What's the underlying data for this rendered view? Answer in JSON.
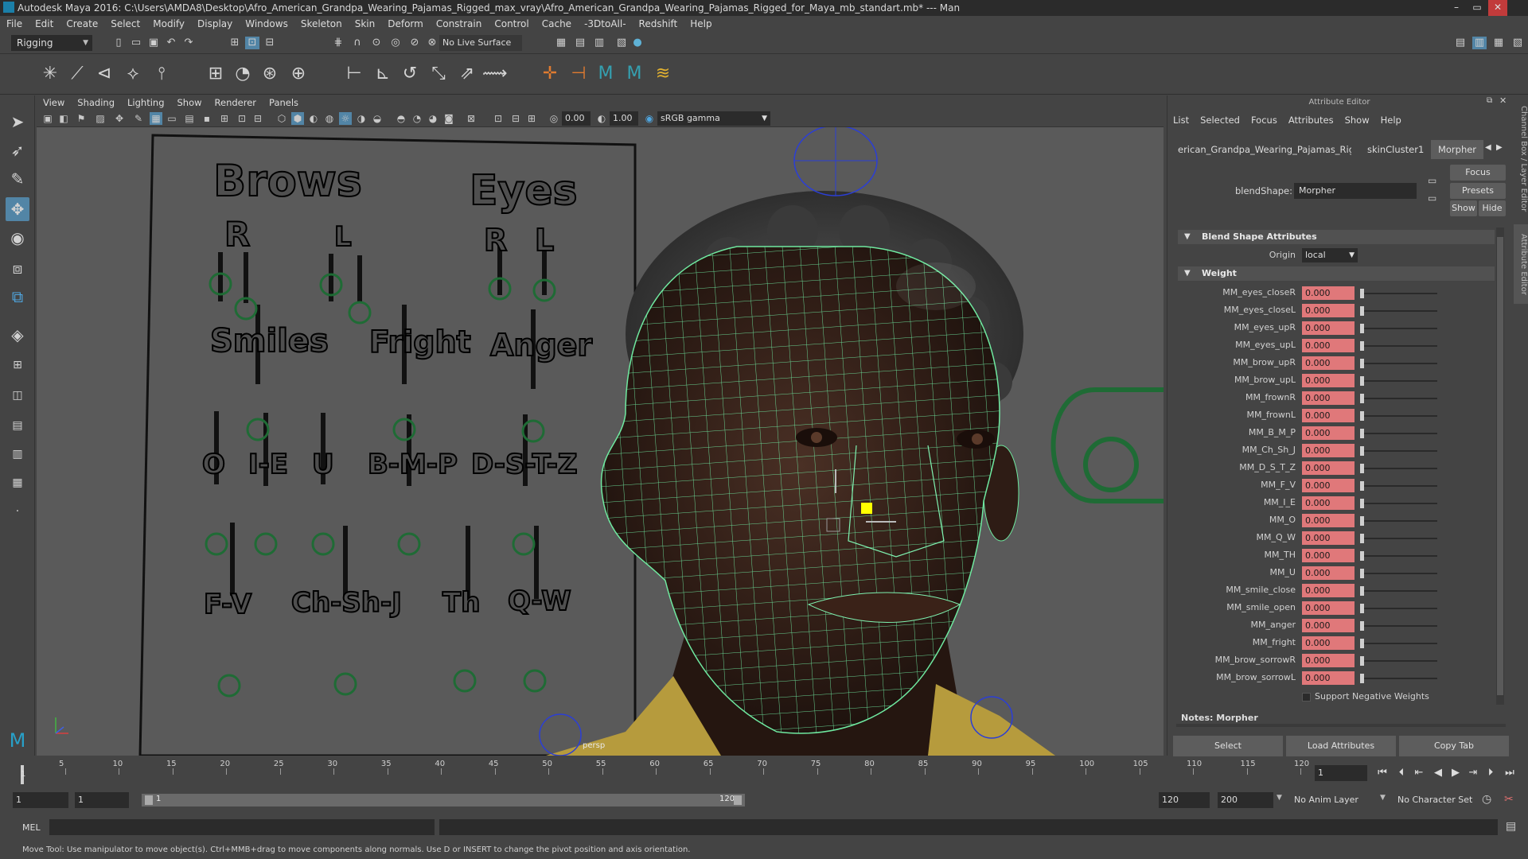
{
  "window": {
    "title": "Autodesk Maya 2016: C:\\Users\\AMDA8\\Desktop\\Afro_American_Grandpa_Wearing_Pajamas_Rigged_max_vray\\Afro_American_Grandpa_Wearing_Pajamas_Rigged_for_Maya_mb_standart.mb* --- Man"
  },
  "menubar": [
    "File",
    "Edit",
    "Create",
    "Select",
    "Modify",
    "Display",
    "Windows",
    "Skeleton",
    "Skin",
    "Deform",
    "Constrain",
    "Control",
    "Cache",
    "-3DtoAll-",
    "Redshift",
    "Help"
  ],
  "statusline": {
    "menuset": "Rigging",
    "live_surface": "No Live Surface"
  },
  "viewport": {
    "menu": [
      "View",
      "Shading",
      "Lighting",
      "Show",
      "Renderer",
      "Panels"
    ],
    "field_a": "0.00",
    "field_b": "1.00",
    "color_space": "sRGB gamma",
    "camera_label": "persp",
    "board": {
      "brows": "Brows",
      "eyes": "Eyes",
      "brows_r": "R",
      "brows_l": "L",
      "eyes_r": "R",
      "eyes_l": "L",
      "smiles": "Smiles",
      "fright": "Fright",
      "anger": "Anger",
      "o": "O",
      "ie": "I-E",
      "u": "U",
      "bmp": "B-M-P",
      "dstz": "D-S-T-Z",
      "fv": "F-V",
      "chshj": "Ch-Sh-J",
      "th": "Th",
      "qw": "Q-W"
    }
  },
  "attribute_editor": {
    "title": "Attribute Editor",
    "menu": [
      "List",
      "Selected",
      "Focus",
      "Attributes",
      "Show",
      "Help"
    ],
    "tabs": [
      "erican_Grandpa_Wearing_Pajamas_Rigged",
      "skinCluster1",
      "Morpher"
    ],
    "blendshape_label": "blendShape:",
    "blendshape_value": "Morpher",
    "focus_btn": "Focus",
    "presets_btn": "Presets",
    "show_btn": "Show",
    "hide_btn": "Hide",
    "section_blend": "Blend Shape Attributes",
    "origin_label": "Origin",
    "origin_value": "local",
    "section_weight": "Weight",
    "weights": [
      {
        "name": "MM_eyes_closeR",
        "value": "0.000"
      },
      {
        "name": "MM_eyes_closeL",
        "value": "0.000"
      },
      {
        "name": "MM_eyes_upR",
        "value": "0.000"
      },
      {
        "name": "MM_eyes_upL",
        "value": "0.000"
      },
      {
        "name": "MM_brow_upR",
        "value": "0.000"
      },
      {
        "name": "MM_brow_upL",
        "value": "0.000"
      },
      {
        "name": "MM_frownR",
        "value": "0.000"
      },
      {
        "name": "MM_frownL",
        "value": "0.000"
      },
      {
        "name": "MM_B_M_P",
        "value": "0.000"
      },
      {
        "name": "MM_Ch_Sh_J",
        "value": "0.000"
      },
      {
        "name": "MM_D_S_T_Z",
        "value": "0.000"
      },
      {
        "name": "MM_F_V",
        "value": "0.000"
      },
      {
        "name": "MM_I_E",
        "value": "0.000"
      },
      {
        "name": "MM_O",
        "value": "0.000"
      },
      {
        "name": "MM_Q_W",
        "value": "0.000"
      },
      {
        "name": "MM_TH",
        "value": "0.000"
      },
      {
        "name": "MM_U",
        "value": "0.000"
      },
      {
        "name": "MM_smile_close",
        "value": "0.000"
      },
      {
        "name": "MM_smile_open",
        "value": "0.000"
      },
      {
        "name": "MM_anger",
        "value": "0.000"
      },
      {
        "name": "MM_fright",
        "value": "0.000"
      },
      {
        "name": "MM_brow_sorrowR",
        "value": "0.000"
      },
      {
        "name": "MM_brow_sorrowL",
        "value": "0.000"
      }
    ],
    "support_negative": "Support Negative Weights",
    "notes": "Notes: Morpher",
    "bottom": {
      "select": "Select",
      "load": "Load Attributes",
      "copy": "Copy Tab"
    },
    "side_tabs": {
      "channel_box": "Channel Box / Layer Editor",
      "attr_editor": "Attribute Editor"
    }
  },
  "timeslider": {
    "ticks": [
      "5",
      "10",
      "15",
      "20",
      "25",
      "30",
      "35",
      "40",
      "45",
      "50",
      "55",
      "60",
      "65",
      "70",
      "75",
      "80",
      "85",
      "90",
      "95",
      "100",
      "105",
      "110",
      "115",
      "120"
    ],
    "current_frame": "1",
    "current_field": "1"
  },
  "rangeslider": {
    "start": "1",
    "anim_start": "1",
    "range_start_label": "1",
    "range_end_label": "120",
    "end": "120",
    "anim_end": "200",
    "anim_layer": "No Anim Layer",
    "char_set": "No Character Set"
  },
  "cmdline": {
    "label": "MEL"
  },
  "helpline": "Move Tool: Use manipulator to move object(s). Ctrl+MMB+drag to move components along normals. Use D or INSERT to change the pivot position and axis orientation."
}
